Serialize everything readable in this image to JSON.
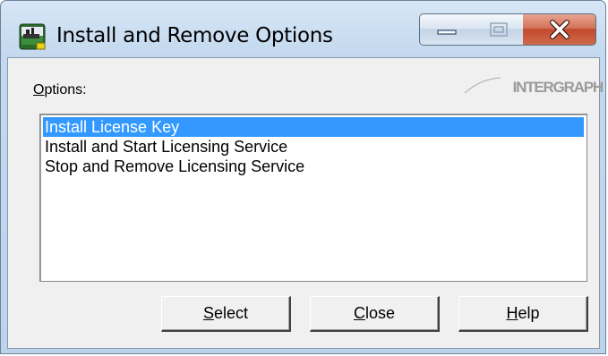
{
  "window": {
    "title": "Install and Remove Options",
    "controls": {
      "minimize": "minimize-icon",
      "maximize": "maximize-icon",
      "close": "close-icon"
    }
  },
  "options": {
    "label_accel": "O",
    "label_rest": "ptions:",
    "items": [
      {
        "label": "Install License Key",
        "selected": true
      },
      {
        "label": "Install and Start Licensing Service",
        "selected": false
      },
      {
        "label": "Stop and Remove Licensing Service",
        "selected": false
      }
    ]
  },
  "logo": {
    "text": "INTERGRAPH"
  },
  "buttons": {
    "select": {
      "accel": "S",
      "rest": "elect"
    },
    "close": {
      "accel": "C",
      "rest": "lose"
    },
    "help": {
      "accel": "H",
      "rest": "elp"
    }
  },
  "colors": {
    "selection": "#3399ff",
    "close_button": "#c24a2c",
    "dialog_face": "#f0f0f0"
  }
}
